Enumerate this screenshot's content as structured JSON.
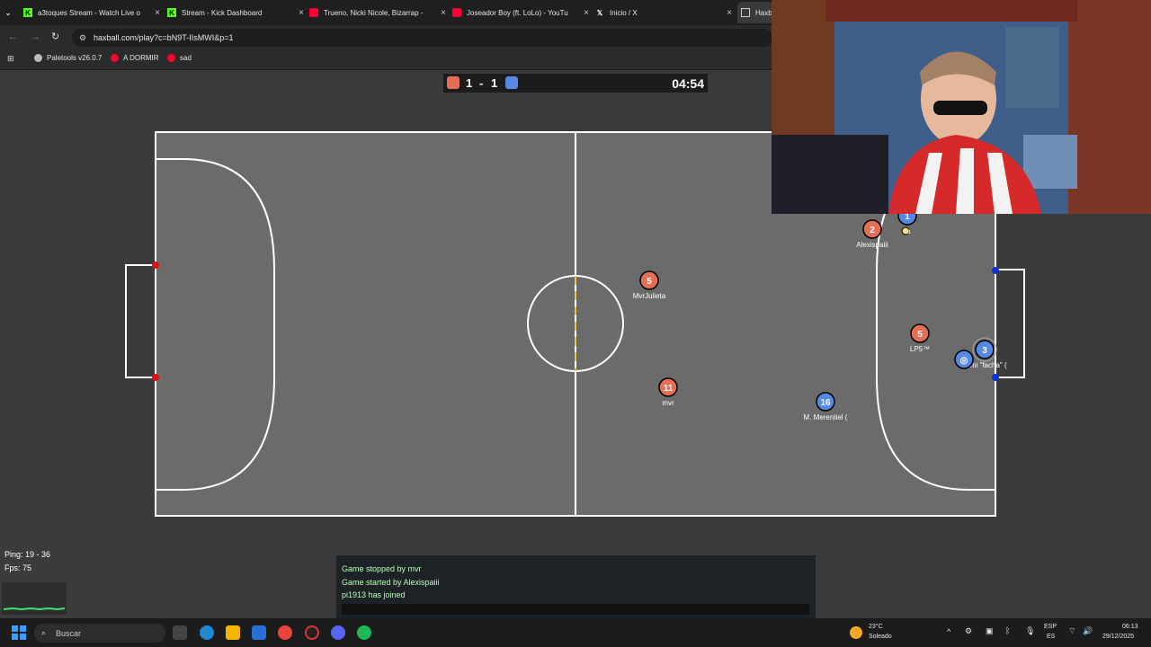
{
  "browser": {
    "tabs": [
      {
        "label": "a3toques Stream - Watch Live o",
        "icon": "kick-icon"
      },
      {
        "label": "Stream - Kick Dashboard",
        "icon": "kick-icon"
      },
      {
        "label": "Trueno, Nicki Nicole, Bizarrap -",
        "icon": "youtube-icon"
      },
      {
        "label": "Joseador Boy (ft. LoLo) - YouTu",
        "icon": "youtube-icon"
      },
      {
        "label": "Inicio / X",
        "icon": "x-icon"
      },
      {
        "label": "Haxb",
        "icon": "haxball-icon"
      }
    ],
    "url": "haxball.com/play?c=bN9T-IIsMWI&p=1",
    "bookmarks": [
      "Paletools v26.0.7",
      "A DORMIR",
      "sad"
    ]
  },
  "game": {
    "score_red": "1",
    "score_sep": "-",
    "score_blue": "1",
    "time": "04:54",
    "players": [
      {
        "num": "5",
        "name": "MvrJulieta",
        "team": "red"
      },
      {
        "num": "11",
        "name": "mvr",
        "team": "red"
      },
      {
        "num": "2",
        "name": "Alexispaiii",
        "team": "red"
      },
      {
        "num": "5",
        "name": "LP5™",
        "team": "red"
      },
      {
        "num": "16",
        "name": "M. Merentiel (",
        "team": "blue"
      },
      {
        "num": "3",
        "name": "Tomi \"facha\" (",
        "team": "blue"
      },
      {
        "num": "◎",
        "name": "",
        "team": "blue"
      },
      {
        "num": "1",
        "name": "ta",
        "team": "blue"
      }
    ],
    "colors": {
      "red": "#e56e56",
      "blue": "#5689e5",
      "field": "#6a6a6a"
    }
  },
  "stats": {
    "ping": "Ping: 19 - 36",
    "fps": "Fps: 75"
  },
  "chat": {
    "messages": [
      "Game stopped by mvr",
      "Game started by Alexispaiii",
      "pi1913 has joined"
    ]
  },
  "taskbar": {
    "search_placeholder": "Buscar",
    "weather_temp": "23°C",
    "weather_desc": "Soleado",
    "lang": "ESP",
    "lang2": "ES",
    "time": "06:13",
    "date": "29/12/2025"
  }
}
